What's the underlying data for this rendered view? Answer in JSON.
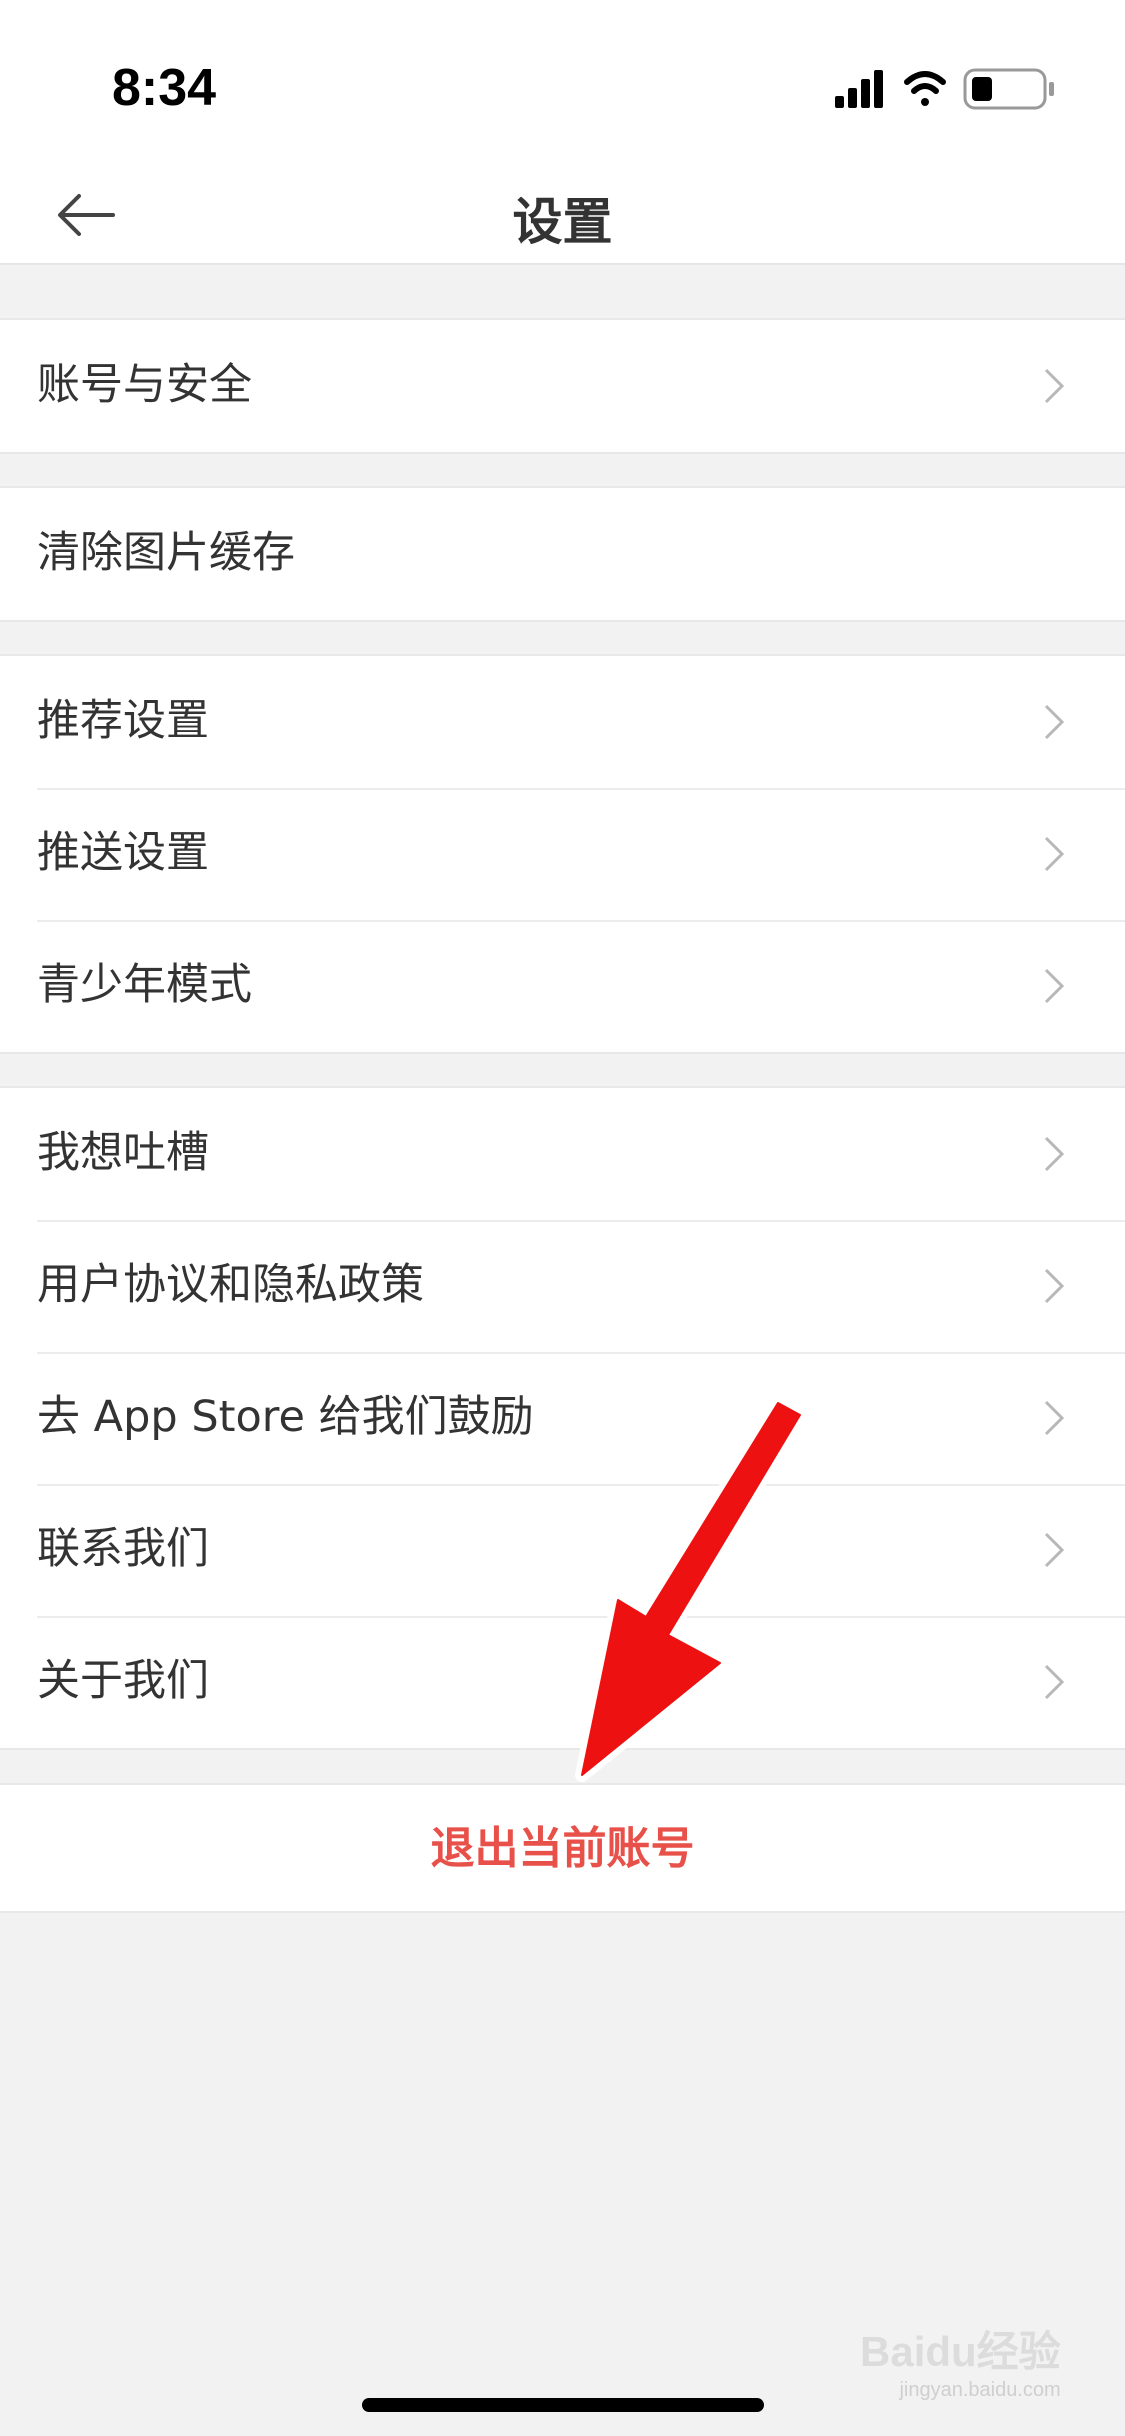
{
  "status_bar": {
    "time": "8:34"
  },
  "nav": {
    "title": "设置"
  },
  "groups": [
    {
      "items": [
        {
          "label": "账号与安全",
          "chevron": true
        }
      ]
    },
    {
      "items": [
        {
          "label": "清除图片缓存",
          "chevron": false
        }
      ]
    },
    {
      "items": [
        {
          "label": "推荐设置",
          "chevron": true
        },
        {
          "label": "推送设置",
          "chevron": true
        },
        {
          "label": "青少年模式",
          "chevron": true
        }
      ]
    },
    {
      "items": [
        {
          "label": "我想吐槽",
          "chevron": true
        },
        {
          "label": "用户协议和隐私政策",
          "chevron": true
        },
        {
          "label": "去 App Store 给我们鼓励",
          "chevron": true
        },
        {
          "label": "联系我们",
          "chevron": true
        },
        {
          "label": "关于我们",
          "chevron": true
        }
      ]
    }
  ],
  "logout": {
    "label": "退出当前账号"
  },
  "watermark": {
    "brand": "Baidu经验",
    "url": "jingyan.baidu.com"
  },
  "colors": {
    "accent": "#e8504a",
    "annotation_arrow": "#ee1111"
  }
}
